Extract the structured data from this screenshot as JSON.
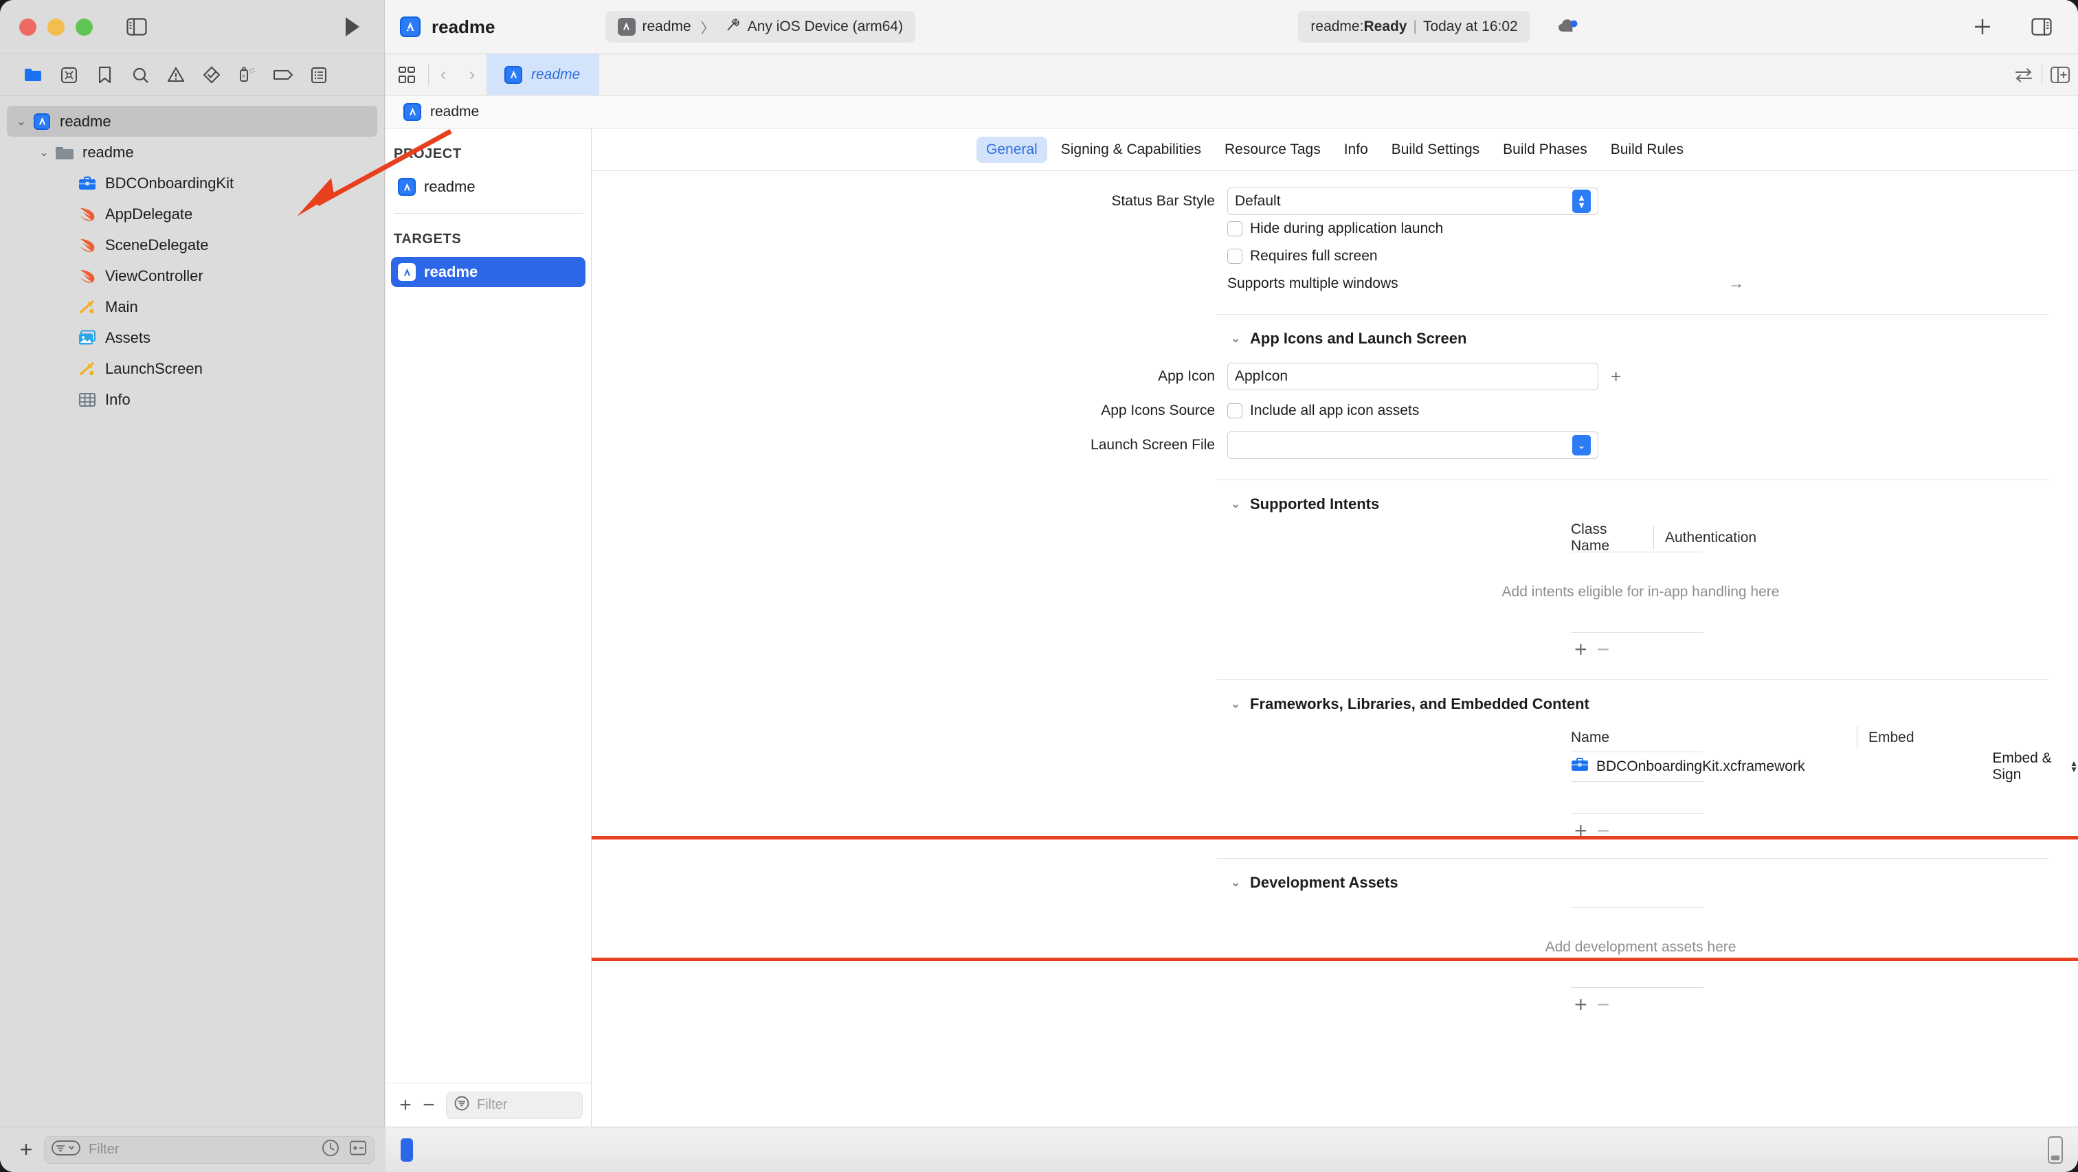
{
  "window": {
    "title": "readme",
    "accent": "#2c67e8",
    "annotation_color": "#e8401f"
  },
  "toolbar": {
    "project_title": "readme",
    "scheme": {
      "target": "readme",
      "separator": "〉",
      "destination": "Any iOS Device (arm64)"
    },
    "status": {
      "prefix": "readme: ",
      "state": "Ready",
      "divider": "|",
      "time": "Today at 16:02"
    },
    "icons": {
      "sidebar_toggle": "sidebar-toggle-icon",
      "run": "run-icon",
      "cloud": "cloud-icon",
      "add": "plus-icon",
      "inspector_toggle": "inspector-toggle-icon"
    }
  },
  "navigator": {
    "toolbar_items": [
      {
        "name": "project-navigator-icon",
        "active": true
      },
      {
        "name": "source-control-navigator-icon",
        "active": false
      },
      {
        "name": "bookmark-navigator-icon",
        "active": false
      },
      {
        "name": "find-navigator-icon",
        "active": false
      },
      {
        "name": "issue-navigator-icon",
        "active": false
      },
      {
        "name": "test-navigator-icon",
        "active": false
      },
      {
        "name": "debug-navigator-icon",
        "active": false
      },
      {
        "name": "breakpoint-navigator-icon",
        "active": false
      },
      {
        "name": "report-navigator-icon",
        "active": false
      }
    ],
    "tree": [
      {
        "label": "readme",
        "icon": "app-project-icon",
        "depth": 0,
        "twisty": "⌄",
        "selected": true
      },
      {
        "label": "readme",
        "icon": "folder-icon",
        "depth": 1,
        "twisty": "⌄",
        "selected": false
      },
      {
        "label": "BDCOnboardingKit",
        "icon": "framework-icon",
        "depth": 2,
        "twisty": "",
        "selected": false
      },
      {
        "label": "AppDelegate",
        "icon": "swift-icon",
        "depth": 2,
        "twisty": "",
        "selected": false
      },
      {
        "label": "SceneDelegate",
        "icon": "swift-icon",
        "depth": 2,
        "twisty": "",
        "selected": false
      },
      {
        "label": "ViewController",
        "icon": "swift-icon",
        "depth": 2,
        "twisty": "",
        "selected": false
      },
      {
        "label": "Main",
        "icon": "storyboard-icon",
        "depth": 2,
        "twisty": "",
        "selected": false
      },
      {
        "label": "Assets",
        "icon": "assets-icon",
        "depth": 2,
        "twisty": "",
        "selected": false
      },
      {
        "label": "LaunchScreen",
        "icon": "storyboard-icon",
        "depth": 2,
        "twisty": "",
        "selected": false
      },
      {
        "label": "Info",
        "icon": "plist-icon",
        "depth": 2,
        "twisty": "",
        "selected": false
      }
    ],
    "filter_placeholder": "Filter"
  },
  "editor": {
    "tab": {
      "label": "readme",
      "icon": "app-project-icon"
    },
    "breadcrumb": {
      "label": "readme",
      "icon": "app-project-icon"
    },
    "nav_back": "‹",
    "nav_forward": "›"
  },
  "project_targets": {
    "project_header": "PROJECT",
    "projects": [
      {
        "label": "readme",
        "icon": "app-project-icon"
      }
    ],
    "targets_header": "TARGETS",
    "targets": [
      {
        "label": "readme",
        "icon": "app-project-icon",
        "active": true
      }
    ],
    "add_label": "+",
    "remove_label": "−",
    "filter_placeholder": "Filter"
  },
  "settings": {
    "tabs": [
      {
        "label": "General",
        "active": true
      },
      {
        "label": "Signing & Capabilities",
        "active": false
      },
      {
        "label": "Resource Tags",
        "active": false
      },
      {
        "label": "Info",
        "active": false
      },
      {
        "label": "Build Settings",
        "active": false
      },
      {
        "label": "Build Phases",
        "active": false
      },
      {
        "label": "Build Rules",
        "active": false
      }
    ],
    "status_bar": {
      "label": "Status Bar Style",
      "value": "Default",
      "hide_launch_label": "Hide during application launch",
      "hide_launch_checked": false,
      "requires_fullscreen_label": "Requires full screen",
      "requires_fullscreen_checked": false,
      "multiple_windows_label": "Supports multiple windows",
      "multiple_windows_arrow": "→"
    },
    "app_icons": {
      "section_title": "App Icons and Launch Screen",
      "app_icon_label": "App Icon",
      "app_icon_value": "AppIcon",
      "app_icon_add": "+",
      "app_icons_source_label": "App Icons Source",
      "include_all_label": "Include all app icon assets",
      "include_all_checked": false,
      "launch_screen_label": "Launch Screen File",
      "launch_screen_value": ""
    },
    "supported_intents": {
      "section_title": "Supported Intents",
      "columns": [
        "Class Name",
        "Authentication"
      ],
      "empty_text": "Add intents eligible for in-app handling here",
      "add_label": "+",
      "remove_label": "−"
    },
    "frameworks": {
      "section_title": "Frameworks, Libraries, and Embedded Content",
      "columns": [
        "Name",
        "Embed"
      ],
      "rows": [
        {
          "name": "BDCOnboardingKit.xcframework",
          "icon": "framework-icon",
          "embed": "Embed & Sign"
        }
      ],
      "add_label": "+",
      "remove_label": "−",
      "highlighted": true
    },
    "development_assets": {
      "section_title": "Development Assets",
      "empty_text": "Add development assets here",
      "add_label": "+",
      "remove_label": "−"
    }
  }
}
